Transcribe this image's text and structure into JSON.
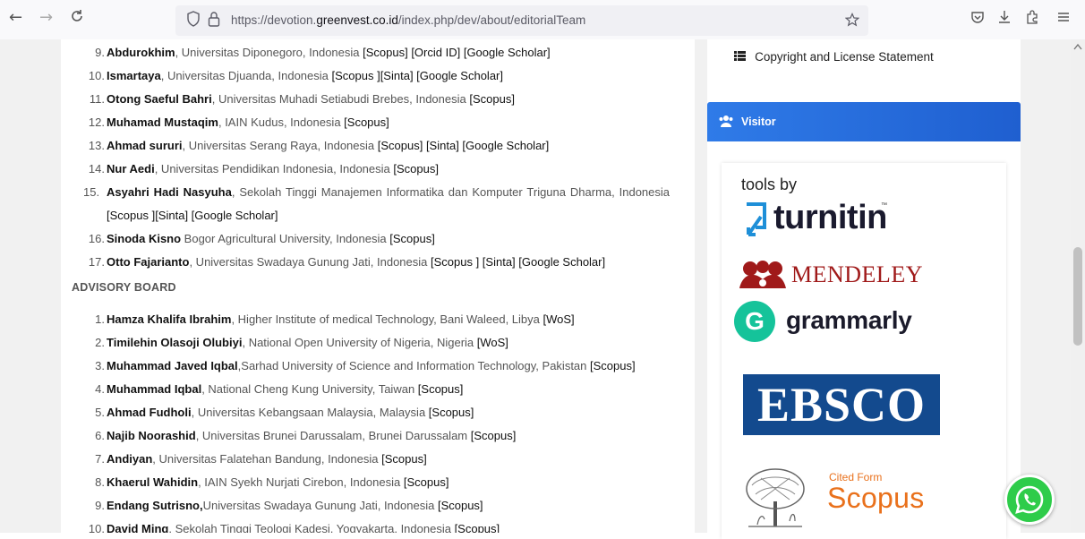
{
  "browser": {
    "back_icon": "←",
    "forward_icon": "→",
    "reload_icon": "C",
    "url_prefix": "https://devotion.",
    "url_domain": "greenvest.co.id",
    "url_suffix": "/index.php/dev/about/editorialTeam"
  },
  "editorial_continued": [
    {
      "num": "9.",
      "name": "Abdurokhim",
      "affil": ", Universitas Diponegoro, Indonesia ",
      "tags": "[Scopus] [Orcid ID] [Google Scholar]"
    },
    {
      "num": "10.",
      "name": "Ismartaya",
      "affil": ", Universitas Djuanda, Indonesia ",
      "tags": "[Scopus ][Sinta] [Google Scholar]"
    },
    {
      "num": "11.",
      "name": "Otong Saeful Bahri",
      "affil": ", Universitas Muhadi Setiabudi Brebes, Indonesia ",
      "tags": "[Scopus]"
    },
    {
      "num": "12.",
      "name": "Muhamad Mustaqim",
      "affil": ", IAIN Kudus, Indonesia ",
      "tags": "[Scopus]"
    },
    {
      "num": "13.",
      "name": "Ahmad sururi",
      "affil": ", Universitas Serang Raya, Indonesia ",
      "tags": "[Scopus] [Sinta] [Google Scholar]"
    },
    {
      "num": "14.",
      "name": "Nur Aedi",
      "affil": ", Universitas Pendidikan Indonesia, Indonesia ",
      "tags": "[Scopus]"
    },
    {
      "num": "15.",
      "name": "Asyahri Hadi Nasyuha",
      "affil": ", Sekolah Tinggi Manajemen Informatika dan Komputer Triguna Dharma, Indonesia ",
      "tags": "[Scopus ][Sinta] [Google Scholar]"
    },
    {
      "num": "16.",
      "name": "Sinoda Kisno",
      "affil": " Bogor Agricultural University, Indonesia ",
      "tags": "[Scopus]"
    },
    {
      "num": "17.",
      "name": "Otto Fajarianto",
      "affil": ", Universitas Swadaya Gunung Jati, Indonesia ",
      "tags": "[Scopus ] [Sinta] [Google Scholar]"
    }
  ],
  "advisory_heading": "ADVISORY BOARD",
  "advisory": [
    {
      "num": "1.",
      "name": "Hamza Khalifa Ibrahim",
      "affil": ", Higher Institute of medical Technology, Bani Waleed, Libya ",
      "tags": "[WoS]"
    },
    {
      "num": "2.",
      "name": "Timilehin Olasoji Olubiyi",
      "affil": ", National Open University of Nigeria, Nigeria ",
      "tags": "[WoS]"
    },
    {
      "num": "3.",
      "name": "Muhammad Javed Iqbal",
      "affil": ",Sarhad University of Science and Information Technology, Pakistan ",
      "tags": "[Scopus]"
    },
    {
      "num": "4.",
      "name": "Muhammad Iqbal",
      "affil": ", National Cheng Kung University, Taiwan ",
      "tags": "[Scopus]"
    },
    {
      "num": "5.",
      "name": "Ahmad Fudholi",
      "affil": ", Universitas Kebangsaan Malaysia, Malaysia ",
      "tags": "[Scopus]"
    },
    {
      "num": "6.",
      "name": "Najib Noorashid",
      "affil": ", Universitas Brunei Darussalam, Brunei Darussalam ",
      "tags": "[Scopus]"
    },
    {
      "num": "7.",
      "name": "Andiyan",
      "affil": ", Universitas Falatehan Bandung, Indonesia ",
      "tags": "[Scopus]"
    },
    {
      "num": "8.",
      "name": "Khaerul Wahidin",
      "affil": ", IAIN Syekh Nurjati Cirebon, Indonesia ",
      "tags": "[Scopus]"
    },
    {
      "num": "9.",
      "name": "Endang Sutrisno,",
      "affil": "Universitas Swadaya Gunung Jati, Indonesia ",
      "tags": "[Scopus]"
    },
    {
      "num": "10.",
      "name": "David Ming",
      "affil": ", Sekolah Tinggi Teologi Kadesi, Yogyakarta, Indonesia ",
      "tags": "[Scopus]"
    }
  ],
  "sidebar": {
    "copyright_label": "Copyright and License Statement",
    "visitor_label": "Visitor",
    "tools_by": "tools by",
    "turnitin": "turnitin",
    "turnitin_tm": "™",
    "mendeley": "MENDELEY",
    "grammarly_g": "G",
    "grammarly": "grammarly",
    "ebsco": "EBSCO",
    "cited_from": "Cited Form",
    "scopus": "Scopus"
  },
  "colors": {
    "visitor_bar": "#2a72e0",
    "mendeley": "#a01a1a",
    "grammarly": "#15c39a",
    "ebsco": "#134a8e",
    "scopus": "#e9711c",
    "whatsapp": "#2ecc4a"
  },
  "icons": {
    "shield": "shield-icon",
    "lock": "lock-icon",
    "star": "star-icon",
    "pocket": "pocket-icon",
    "download": "download-icon",
    "extensions": "extensions-icon",
    "menu": "menu-icon",
    "list": "list-icon",
    "users": "users-icon",
    "whatsapp": "whatsapp-icon"
  }
}
